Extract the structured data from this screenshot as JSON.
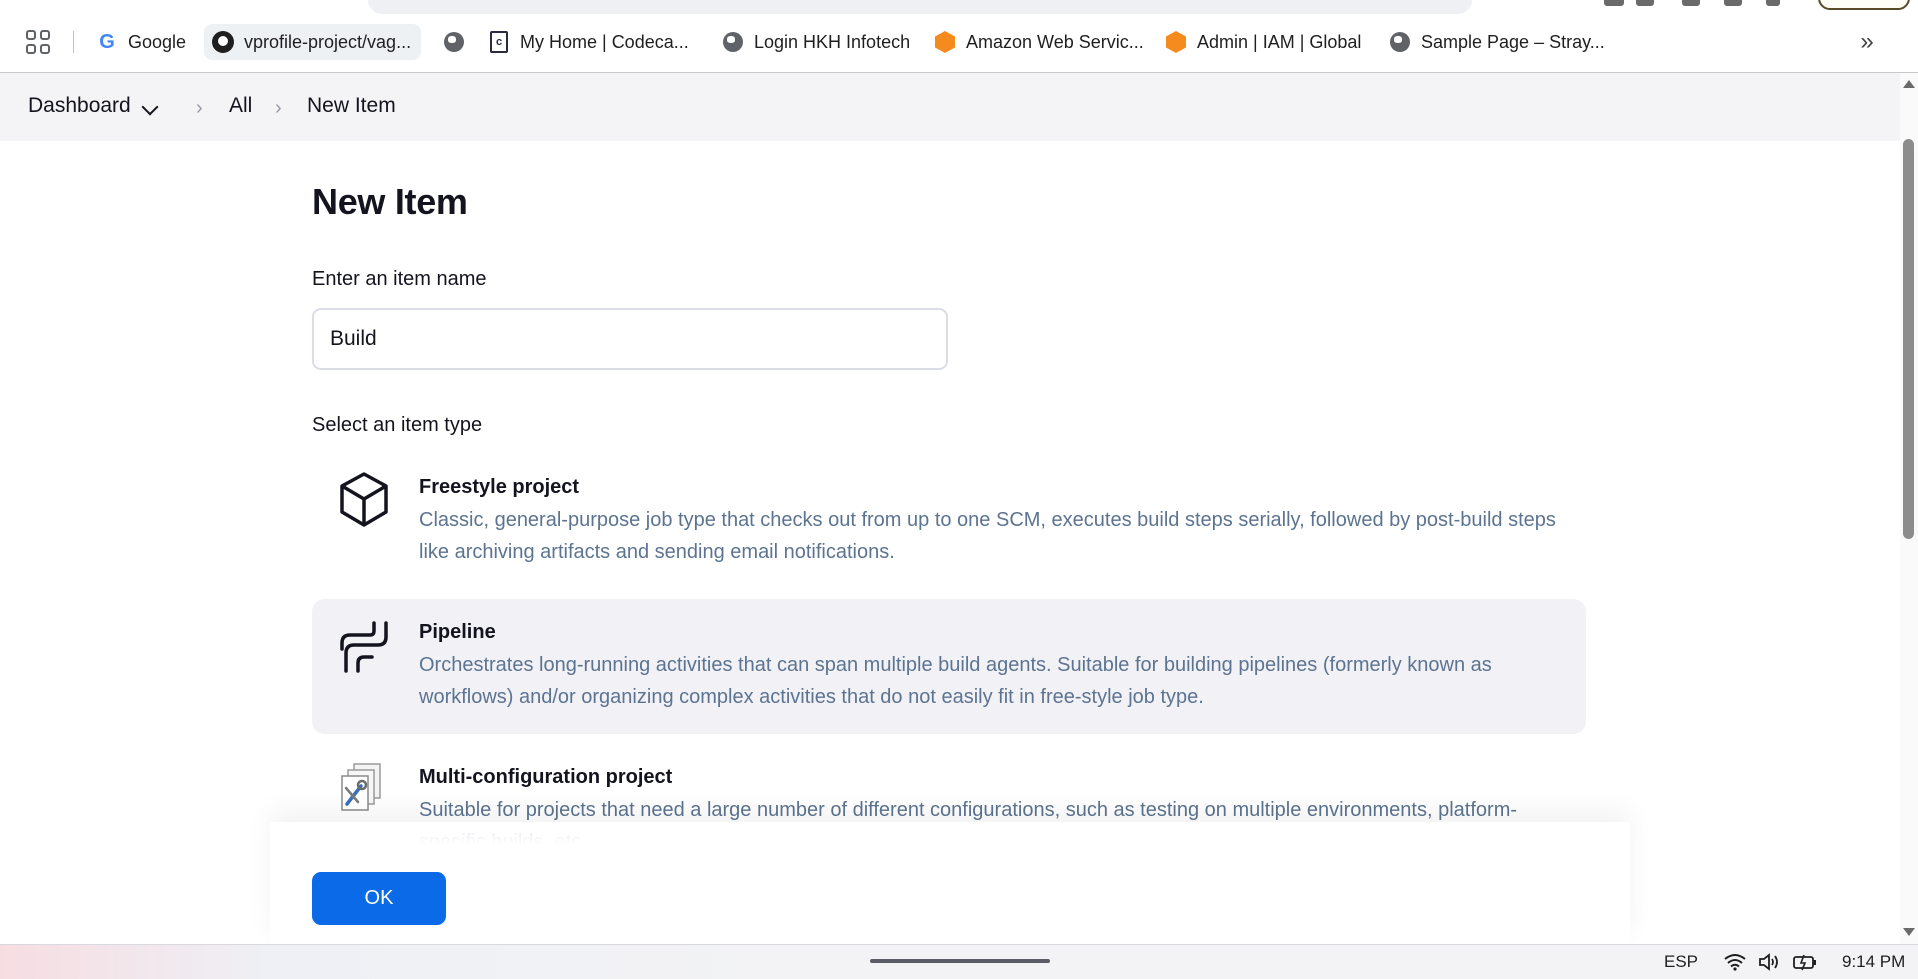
{
  "bookmarks": [
    {
      "label": "Google",
      "icon": "google-icon"
    },
    {
      "label": "vprofile-project/vag...",
      "icon": "github-icon"
    },
    {
      "label": "",
      "icon": "globe-icon"
    },
    {
      "label": "My Home | Codeca...",
      "icon": "codecademy-icon"
    },
    {
      "label": "Login HKH Infotech",
      "icon": "globe-icon"
    },
    {
      "label": "Amazon Web Servic...",
      "icon": "aws-icon"
    },
    {
      "label": "Admin | IAM | Global",
      "icon": "aws-icon"
    },
    {
      "label": "Sample Page – Stray...",
      "icon": "globe-icon"
    }
  ],
  "breadcrumb": {
    "items": [
      "Dashboard",
      "All",
      "New Item"
    ]
  },
  "page": {
    "title": "New Item",
    "name_label": "Enter an item name",
    "name_value": "Build",
    "type_label": "Select an item type",
    "item_types": [
      {
        "title": "Freestyle project",
        "description": "Classic, general-purpose job type that checks out from up to one SCM, executes build steps serially, followed by post-build steps like archiving artifacts and sending email notifications.",
        "icon": "freestyle-box-icon",
        "selected": false
      },
      {
        "title": "Pipeline",
        "description": "Orchestrates long-running activities that can span multiple build agents. Suitable for building pipelines (formerly known as workflows) and/or organizing complex activities that do not easily fit in free-style job type.",
        "icon": "pipeline-icon",
        "selected": true
      },
      {
        "title": "Multi-configuration project",
        "description": "Suitable for projects that need a large number of different configurations, such as testing on multiple environments, platform-specific builds, etc.",
        "icon": "multi-config-icon",
        "selected": false
      }
    ],
    "ok_label": "OK"
  },
  "taskbar": {
    "language": "ESP",
    "time": "9:14 PM"
  },
  "colors": {
    "accent": "#0b6ae7",
    "description_text": "#5c7491",
    "selected_card": "#f1f1f6",
    "breadcrumb_bg": "#f4f4f6"
  }
}
